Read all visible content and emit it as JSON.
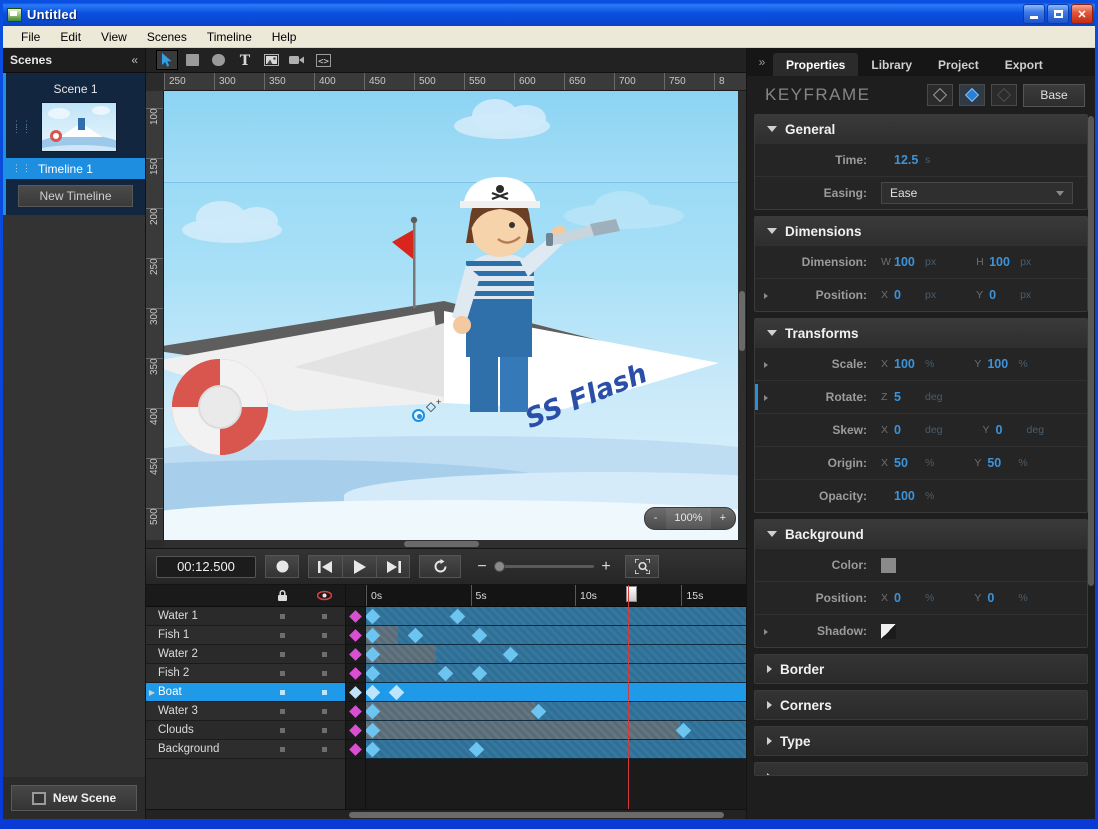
{
  "window": {
    "title": "Untitled",
    "icon": "app-icon",
    "buttons": {
      "minimize": "_",
      "maximize": "□",
      "close": "✕"
    }
  },
  "menubar": {
    "items": [
      "File",
      "Edit",
      "View",
      "Scenes",
      "Timeline",
      "Help"
    ]
  },
  "scenes_panel": {
    "header": "Scenes",
    "collapse_icon": "«",
    "scene_title": "Scene 1",
    "timeline_item": "Timeline 1",
    "new_timeline_button": "New Timeline",
    "new_scene_button": "New Scene"
  },
  "canvas": {
    "tools": [
      {
        "name": "pointer-tool",
        "icon": "cursor-arrow-icon",
        "selected": true
      },
      {
        "name": "rectangle-tool",
        "icon": "square-icon",
        "selected": false
      },
      {
        "name": "ellipse-tool",
        "icon": "circle-icon",
        "selected": false
      },
      {
        "name": "text-tool",
        "icon": "text-T-icon",
        "selected": false
      },
      {
        "name": "image-tool",
        "icon": "picture-icon",
        "selected": false
      },
      {
        "name": "video-tool",
        "icon": "video-camera-icon",
        "selected": false
      },
      {
        "name": "code-tool",
        "icon": "code-brackets-icon",
        "selected": false
      }
    ],
    "ruler_h": [
      "250",
      "300",
      "350",
      "400",
      "450",
      "500",
      "550",
      "600",
      "650",
      "700",
      "750",
      "8"
    ],
    "ruler_v": [
      "100",
      "150",
      "200",
      "250",
      "300",
      "350",
      "400",
      "450",
      "500"
    ],
    "artwork_text": "SS Flash",
    "zoom": {
      "minus": "-",
      "value": "100%",
      "plus": "+"
    }
  },
  "playback": {
    "timecode": "00:12.500",
    "record": "record-button",
    "prev": "skip-previous-button",
    "play": "play-button",
    "next": "skip-next-button",
    "loop": "loop-button",
    "zoom_out": "−",
    "zoom_in": "+",
    "fit": "fit-to-view-button"
  },
  "timeline": {
    "col_icons": [
      {
        "name": "lock-icon",
        "glyph": "lock"
      },
      {
        "name": "visibility-icon",
        "glyph": "eye"
      }
    ],
    "ruler_marks": [
      "0s",
      "5s",
      "10s",
      "15s"
    ],
    "playhead_time": "12.5",
    "layers": [
      {
        "name": "Water 1",
        "selected": false,
        "bar_end_pct": 0,
        "keyframes": [
          23
        ]
      },
      {
        "name": "Fish 1",
        "selected": false,
        "bar_end_pct": 9,
        "keyframes": [
          12,
          29
        ]
      },
      {
        "name": "Water 2",
        "selected": false,
        "bar_end_pct": 18,
        "keyframes": [
          37
        ]
      },
      {
        "name": "Fish 2",
        "selected": false,
        "bar_end_pct": 0,
        "keyframes": [
          20,
          29
        ]
      },
      {
        "name": "Boat",
        "selected": true,
        "bar_end_pct": 0,
        "keyframes": [
          7
        ]
      },
      {
        "name": "Water 3",
        "selected": false,
        "bar_end_pct": 45,
        "keyframes": [
          45
        ]
      },
      {
        "name": "Clouds",
        "selected": false,
        "bar_end_pct": 83,
        "keyframes": [
          83
        ]
      },
      {
        "name": "Background",
        "selected": false,
        "bar_end_pct": 0,
        "keyframes": [
          28
        ]
      }
    ]
  },
  "properties": {
    "tabs": [
      {
        "label": "Properties",
        "active": true
      },
      {
        "label": "Library",
        "active": false
      },
      {
        "label": "Project",
        "active": false
      },
      {
        "label": "Export",
        "active": false
      }
    ],
    "collapse_icon": "»",
    "title": "KEYFRAME",
    "keyframe_buttons": {
      "prev": "previous-keyframe",
      "add": "add-keyframe",
      "next": "next-keyframe"
    },
    "base_button": "Base",
    "groups": [
      {
        "title": "General",
        "open": true
      },
      {
        "title": "Dimensions",
        "open": true
      },
      {
        "title": "Transforms",
        "open": true
      },
      {
        "title": "Background",
        "open": true
      },
      {
        "title": "Border",
        "open": false
      },
      {
        "title": "Corners",
        "open": false
      },
      {
        "title": "Type",
        "open": false
      }
    ],
    "general": {
      "time_label": "Time:",
      "time_value": "12.5",
      "time_unit": "s",
      "easing_label": "Easing:",
      "easing_value": "Ease"
    },
    "dimensions": {
      "dimension_label": "Dimension:",
      "w_axis": "W",
      "w_value": "100",
      "w_unit": "px",
      "h_axis": "H",
      "h_value": "100",
      "h_unit": "px",
      "position_label": "Position:",
      "x_axis": "X",
      "x_value": "0",
      "x_unit": "px",
      "y_axis": "Y",
      "y_value": "0",
      "y_unit": "px"
    },
    "transforms": {
      "scale_label": "Scale:",
      "scale_x_axis": "X",
      "scale_x": "100",
      "scale_x_unit": "%",
      "scale_y_axis": "Y",
      "scale_y": "100",
      "scale_y_unit": "%",
      "rotate_label": "Rotate:",
      "rotate_axis": "Z",
      "rotate_z": "5",
      "rotate_unit": "deg",
      "skew_label": "Skew:",
      "skew_x_axis": "X",
      "skew_x": "0",
      "skew_x_unit": "deg",
      "skew_y_axis": "Y",
      "skew_y": "0",
      "skew_y_unit": "deg",
      "origin_label": "Origin:",
      "origin_x_axis": "X",
      "origin_x": "50",
      "origin_x_unit": "%",
      "origin_y_axis": "Y",
      "origin_y": "50",
      "origin_y_unit": "%",
      "opacity_label": "Opacity:",
      "opacity": "100",
      "opacity_unit": "%"
    },
    "background": {
      "color_label": "Color:",
      "color_value": "#8a8a8a",
      "position_label": "Position:",
      "x_axis": "X",
      "x_value": "0",
      "x_unit": "%",
      "y_axis": "Y",
      "y_value": "0",
      "y_unit": "%",
      "shadow_label": "Shadow:"
    }
  },
  "colors": {
    "accent_blue": "#1e9ae8",
    "value_blue": "#3d93d8",
    "keyframe_magenta": "#d94fd2",
    "keyframe_cyan": "#6cc4f0",
    "playhead_red": "#d23b3b",
    "titlebar_blue": "#0a4fe0"
  }
}
